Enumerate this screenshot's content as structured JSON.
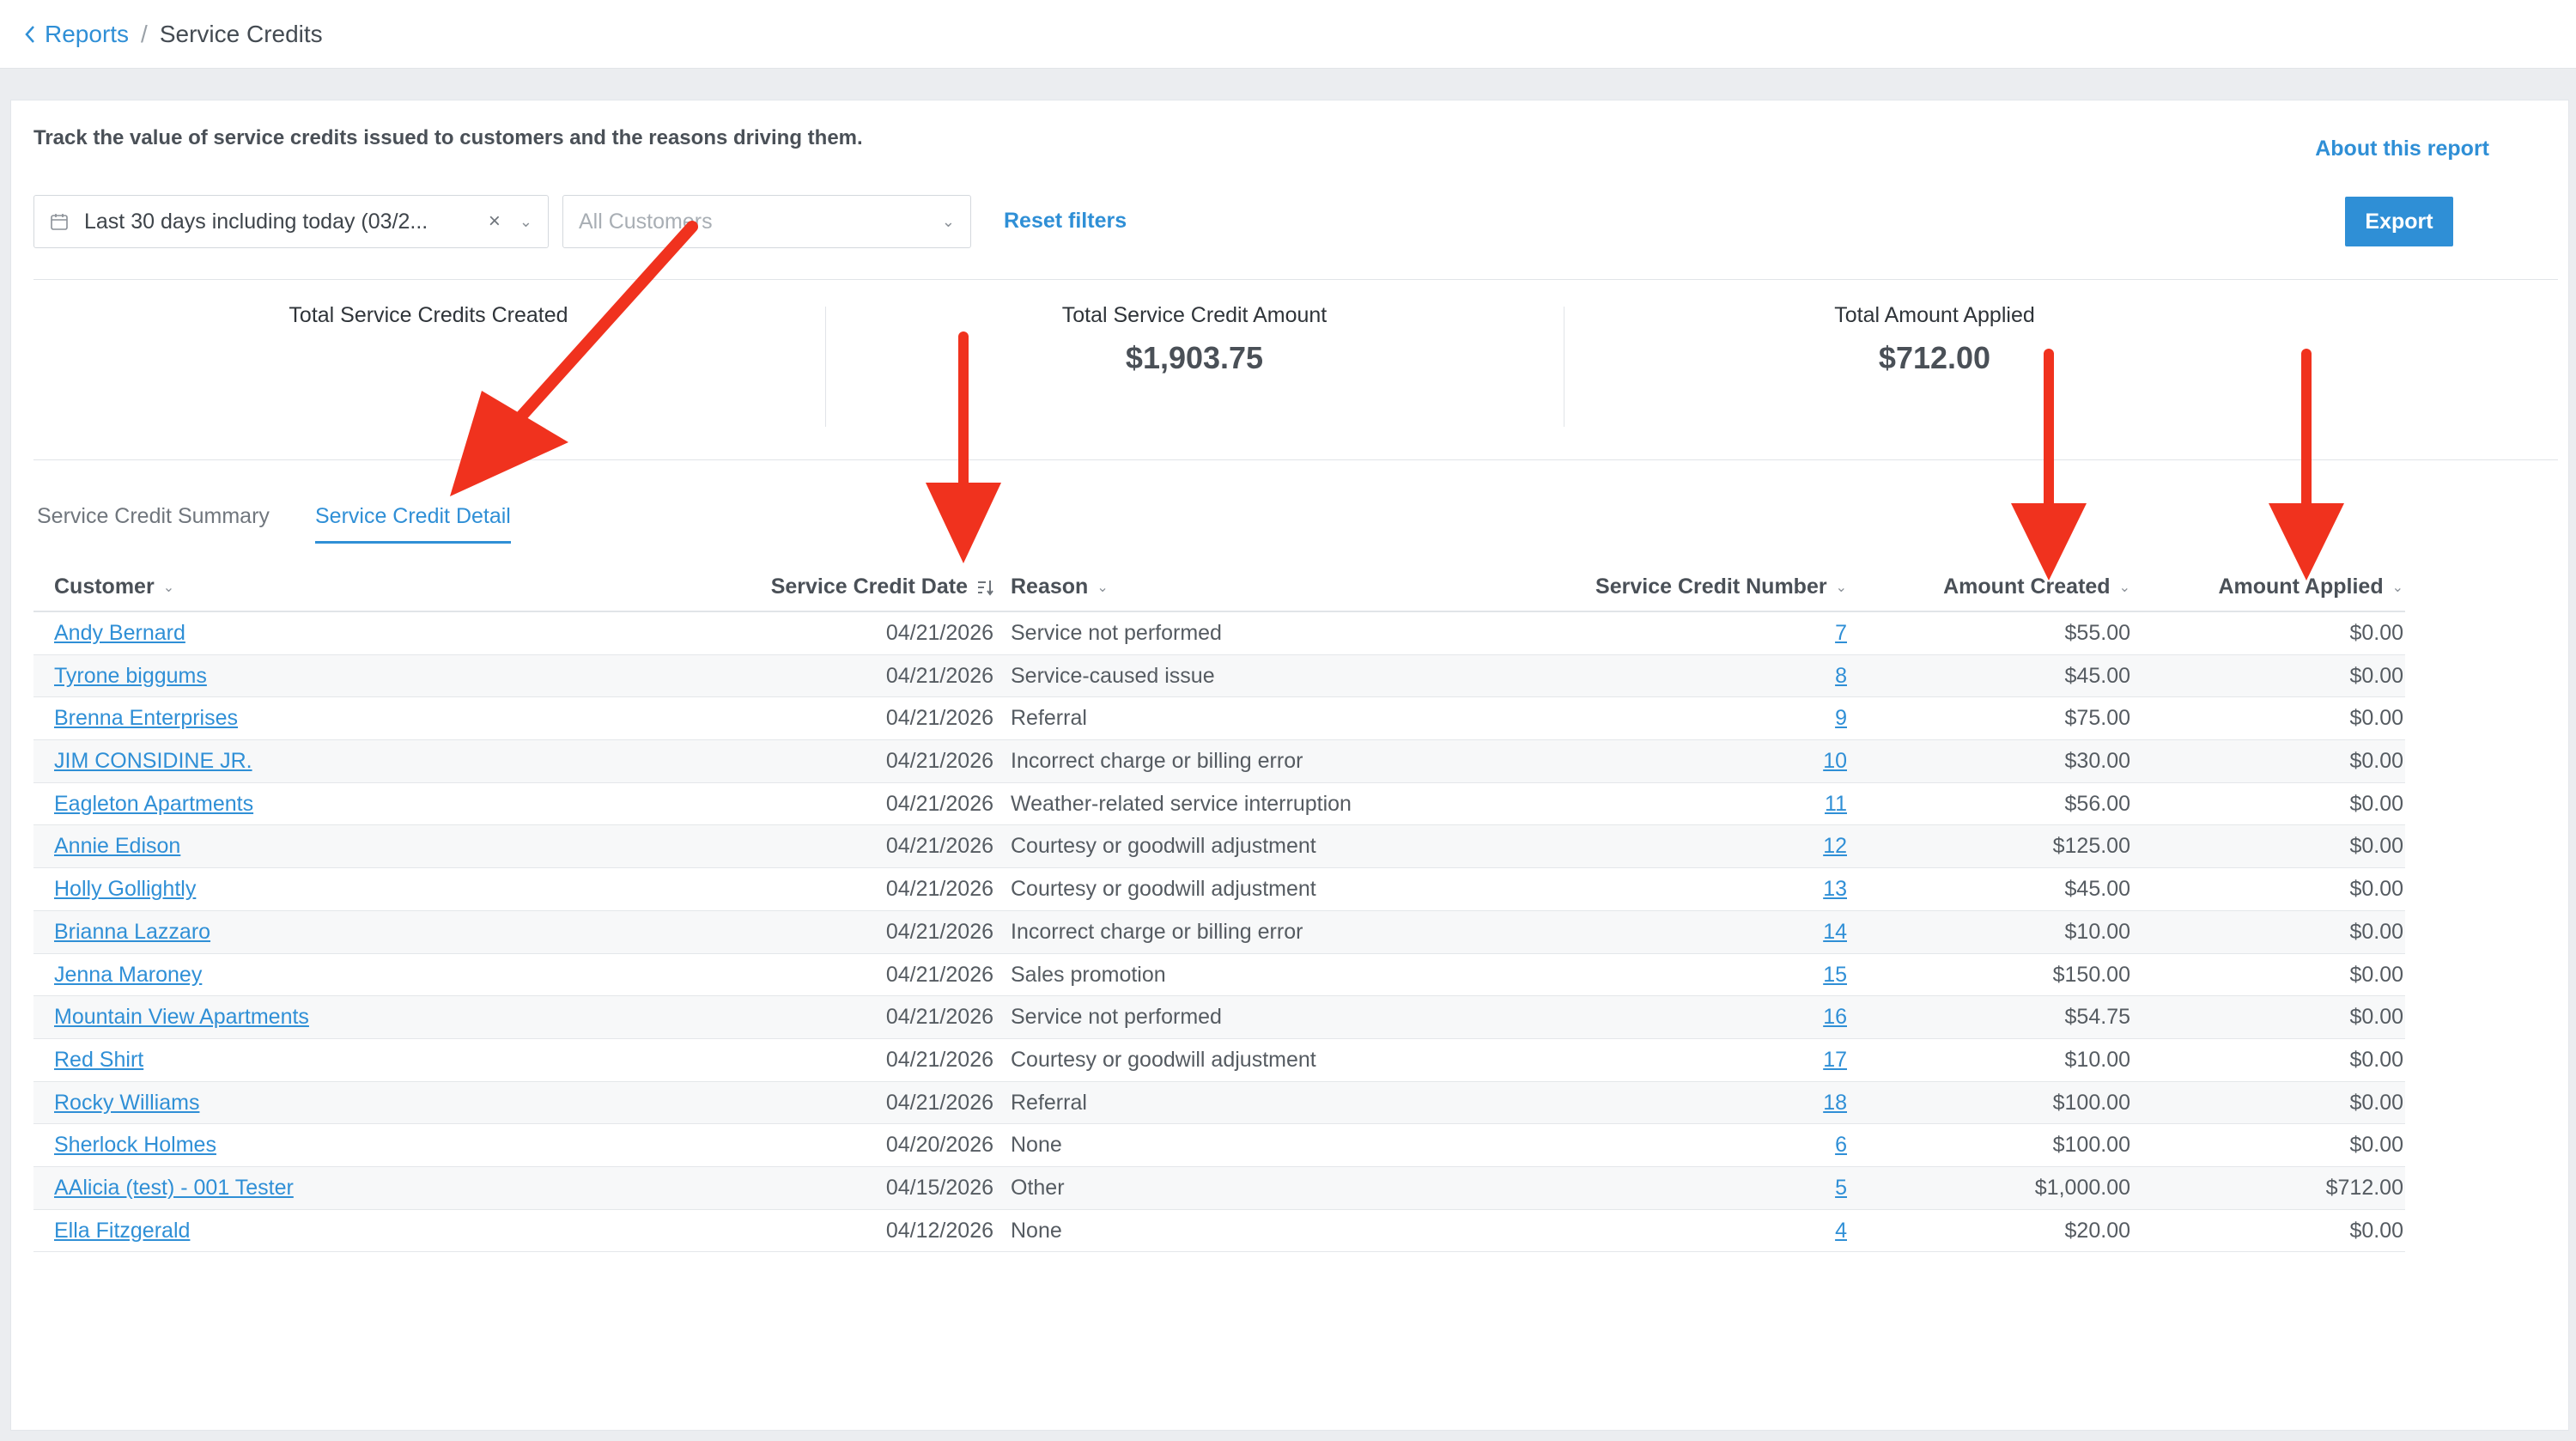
{
  "breadcrumb": {
    "back_label": "Reports",
    "separator": "/",
    "current": "Service Credits"
  },
  "description": "Track the value of service credits issued to customers and the reasons driving them.",
  "about_link": "About this report",
  "filters": {
    "date_range": "Last 30 days including today (03/2...",
    "clear_symbol": "×",
    "customer_placeholder": "All Customers",
    "reset_label": "Reset filters"
  },
  "export_label": "Export",
  "metrics": [
    {
      "label": "Total Service Credits Created",
      "value": ""
    },
    {
      "label": "Total Service Credit Amount",
      "value": "$1,903.75"
    },
    {
      "label": "Total Amount Applied",
      "value": "$712.00"
    }
  ],
  "tabs": [
    {
      "label": "Service Credit Summary",
      "active": false
    },
    {
      "label": "Service Credit Detail",
      "active": true
    }
  ],
  "table": {
    "headers": {
      "customer": "Customer",
      "date": "Service Credit Date",
      "reason": "Reason",
      "number": "Service Credit Number",
      "created": "Amount Created",
      "applied": "Amount Applied"
    },
    "rows": [
      {
        "customer": "Andy Bernard",
        "date": "04/21/2026",
        "reason": "Service not performed",
        "number": "7",
        "created": "$55.00",
        "applied": "$0.00"
      },
      {
        "customer": "Tyrone biggums",
        "date": "04/21/2026",
        "reason": "Service-caused issue",
        "number": "8",
        "created": "$45.00",
        "applied": "$0.00"
      },
      {
        "customer": "Brenna Enterprises",
        "date": "04/21/2026",
        "reason": "Referral",
        "number": "9",
        "created": "$75.00",
        "applied": "$0.00"
      },
      {
        "customer": "JIM CONSIDINE JR.",
        "date": "04/21/2026",
        "reason": "Incorrect charge or billing error",
        "number": "10",
        "created": "$30.00",
        "applied": "$0.00"
      },
      {
        "customer": "Eagleton Apartments",
        "date": "04/21/2026",
        "reason": "Weather-related service interruption",
        "number": "11",
        "created": "$56.00",
        "applied": "$0.00"
      },
      {
        "customer": "Annie Edison",
        "date": "04/21/2026",
        "reason": "Courtesy or goodwill adjustment",
        "number": "12",
        "created": "$125.00",
        "applied": "$0.00"
      },
      {
        "customer": "Holly Gollightly",
        "date": "04/21/2026",
        "reason": "Courtesy or goodwill adjustment",
        "number": "13",
        "created": "$45.00",
        "applied": "$0.00"
      },
      {
        "customer": "Brianna Lazzaro",
        "date": "04/21/2026",
        "reason": "Incorrect charge or billing error",
        "number": "14",
        "created": "$10.00",
        "applied": "$0.00"
      },
      {
        "customer": "Jenna Maroney",
        "date": "04/21/2026",
        "reason": "Sales promotion",
        "number": "15",
        "created": "$150.00",
        "applied": "$0.00"
      },
      {
        "customer": "Mountain View Apartments",
        "date": "04/21/2026",
        "reason": "Service not performed",
        "number": "16",
        "created": "$54.75",
        "applied": "$0.00"
      },
      {
        "customer": "Red Shirt",
        "date": "04/21/2026",
        "reason": "Courtesy or goodwill adjustment",
        "number": "17",
        "created": "$10.00",
        "applied": "$0.00"
      },
      {
        "customer": "Rocky Williams",
        "date": "04/21/2026",
        "reason": "Referral",
        "number": "18",
        "created": "$100.00",
        "applied": "$0.00"
      },
      {
        "customer": "Sherlock  Holmes",
        "date": "04/20/2026",
        "reason": "None",
        "number": "6",
        "created": "$100.00",
        "applied": "$0.00"
      },
      {
        "customer": "AAlicia (test) - 001 Tester",
        "date": "04/15/2026",
        "reason": "Other",
        "number": "5",
        "created": "$1,000.00",
        "applied": "$712.00"
      },
      {
        "customer": "Ella Fitzgerald",
        "date": "04/12/2026",
        "reason": "None",
        "number": "4",
        "created": "$20.00",
        "applied": "$0.00"
      }
    ]
  },
  "colors": {
    "accent": "#2f8fd6",
    "annotation_arrow": "#f0321e"
  },
  "icons": [
    "chevron-left-icon",
    "calendar-icon",
    "clear-icon",
    "chevron-down-icon",
    "sort-desc-icon",
    "annotation-arrow-icon"
  ]
}
